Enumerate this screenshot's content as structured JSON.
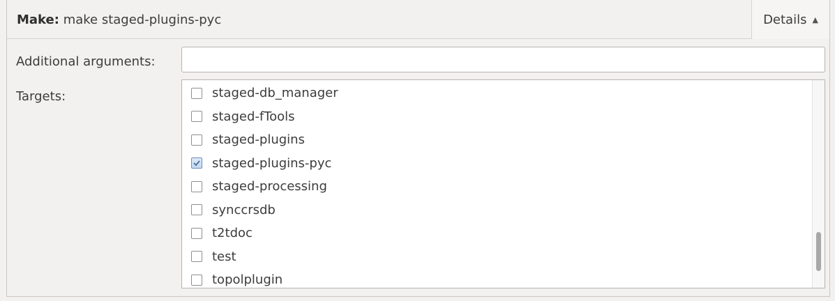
{
  "header": {
    "label": "Make:",
    "command": "make staged-plugins-pyc",
    "details_label": "Details",
    "details_icon": "triangle-up-icon"
  },
  "args": {
    "label": "Additional arguments:",
    "value": "",
    "placeholder": ""
  },
  "targets": {
    "label": "Targets:",
    "items": [
      {
        "label": "staged-db_manager",
        "checked": false
      },
      {
        "label": "staged-fTools",
        "checked": false
      },
      {
        "label": "staged-plugins",
        "checked": false
      },
      {
        "label": "staged-plugins-pyc",
        "checked": true
      },
      {
        "label": "staged-processing",
        "checked": false
      },
      {
        "label": "synccrsdb",
        "checked": false
      },
      {
        "label": "t2tdoc",
        "checked": false
      },
      {
        "label": "test",
        "checked": false
      },
      {
        "label": "topolplugin",
        "checked": false
      }
    ]
  },
  "colors": {
    "background": "#f2f1f0",
    "checkbox_checked": "#6a8fbf",
    "text": "#3c3c3c"
  }
}
